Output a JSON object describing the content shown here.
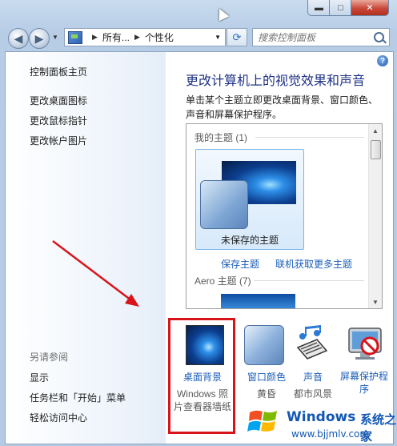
{
  "window": {
    "close_glyph": "✕",
    "max_glyph": "□",
    "min_glyph": "▬"
  },
  "navbar": {
    "breadcrumb": [
      "所有...",
      "个性化"
    ],
    "breadcrumb_sep": "▶",
    "search_placeholder": "搜索控制面板"
  },
  "sidebar": {
    "links": [
      "控制面板主页",
      "更改桌面图标",
      "更改鼠标指针",
      "更改帐户图片"
    ],
    "see_also_title": "另请参阅",
    "see_also_links": [
      "显示",
      "任务栏和「开始」菜单",
      "轻松访问中心"
    ]
  },
  "main": {
    "title": "更改计算机上的视觉效果和声音",
    "description": "单击某个主题立即更改桌面背景、窗口颜色、声音和屏幕保护程序。",
    "my_themes_header": "我的主题 (1)",
    "unsaved_theme": "未保存的主题",
    "save_theme": "保存主题",
    "get_more_themes": "联机获取更多主题",
    "aero_header": "Aero 主题 (7)"
  },
  "bottom": {
    "desktop_bg": {
      "label": "桌面背景",
      "sub": "Windows 照片查看器墙纸"
    },
    "window_color": {
      "label": "窗口颜色",
      "sub": "黄昏"
    },
    "sounds": {
      "label": "声音",
      "sub": "都市风景"
    },
    "screen_saver": {
      "label": "屏幕保护程序"
    }
  },
  "watermark": {
    "brand": "Windows",
    "cn": "系统之家",
    "url": "www.bjjmlv.com"
  },
  "colors": {
    "accent_title": "#1e3287",
    "link": "#1b5eb8",
    "annotation_red": "#d7141a"
  },
  "icons": [
    "back-icon",
    "forward-icon",
    "control-panel-icon",
    "refresh-icon",
    "search-icon",
    "help-icon"
  ]
}
